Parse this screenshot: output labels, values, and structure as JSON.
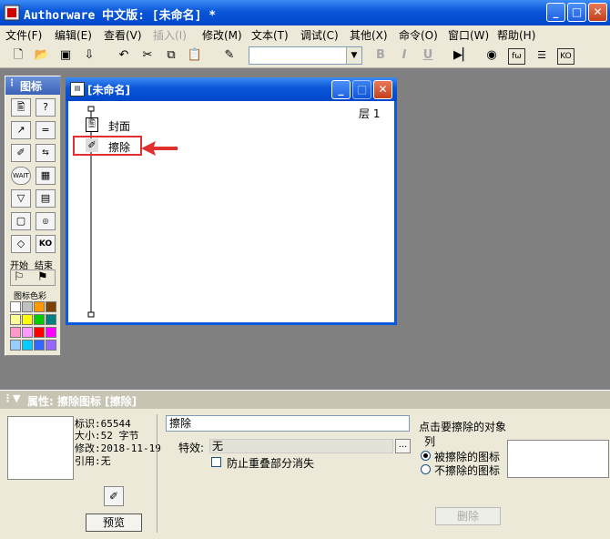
{
  "window": {
    "title": "Authorware  中文版: [未命名] *",
    "minimize": "_",
    "maximize": "□",
    "close": "✕"
  },
  "menu": [
    {
      "label": "文件(F)",
      "disabled": false
    },
    {
      "label": "编辑(E)",
      "disabled": false
    },
    {
      "label": "查看(V)",
      "disabled": false
    },
    {
      "label": "插入(I)",
      "disabled": true
    },
    {
      "label": "修改(M)",
      "disabled": false
    },
    {
      "label": "文本(T)",
      "disabled": false
    },
    {
      "label": "调试(C)",
      "disabled": false
    },
    {
      "label": "其他(X)",
      "disabled": false
    },
    {
      "label": "命令(O)",
      "disabled": false
    },
    {
      "label": "窗口(W)",
      "disabled": false
    },
    {
      "label": "帮助(H)",
      "disabled": false
    }
  ],
  "toolbar": {
    "bold": "B",
    "italic": "I",
    "underline": "U",
    "font_value": ""
  },
  "palette": {
    "title": "图标",
    "start_label": "开始",
    "end_label": "结束",
    "color_title": "图标色彩",
    "wait_label": "WAIT",
    "ko_label": "KO",
    "colors": [
      "#ffffff",
      "#c0c0c0",
      "#ff9900",
      "#804000",
      "#ffff99",
      "#ffff00",
      "#00cc00",
      "#008080",
      "#ff99cc",
      "#ff99ff",
      "#ff0000",
      "#ff00ff",
      "#99ccff",
      "#00ccff",
      "#3366ff",
      "#9966ff"
    ]
  },
  "flow": {
    "title": "[未命名]",
    "layer": "层 1",
    "icons": [
      {
        "label": "封面"
      },
      {
        "label": "擦除"
      }
    ]
  },
  "props": {
    "header": "属性: 擦除图标 [擦除]",
    "id_line": "标识:65544",
    "size_line": "大小:52 字节",
    "modified_line": "修改:2018-11-19",
    "ref_line": "引用:无",
    "preview_button": "预览",
    "name_value": "擦除",
    "effect_label": "特效:",
    "effect_value": "无",
    "browse_button": "...",
    "prevent_label": "防止重叠部分消失",
    "instruction": "点击要擦除的对象",
    "list_label": "列",
    "radio_erase": "被擦除的图标",
    "radio_keep": "不擦除的图标",
    "delete_button": "删除"
  },
  "colors": {
    "accent": "#0a56d8",
    "highlight": "#e03030"
  }
}
